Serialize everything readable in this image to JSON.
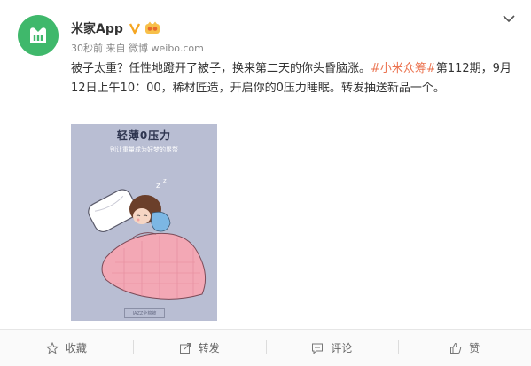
{
  "post": {
    "username": "米家App",
    "time": "30秒前",
    "source_prefix": "来自",
    "source": "微博 weibo.com",
    "text_part1": "被子太重？任性地蹬开了被子，换来第二天的你头昏脑涨。",
    "topic": "#小米众筹#",
    "text_part2": "第112期，9月12日上午10：00，稀材匠造，开启你的0压力睡眠。转发抽送新品一个。"
  },
  "image": {
    "title": "轻薄0压力",
    "subtitle": "别让重量成为好梦的累赘",
    "footer": "JAZZ全棉被"
  },
  "actions": {
    "favorite": "收藏",
    "repost": "转发",
    "comment": "评论",
    "like": "赞"
  },
  "colors": {
    "avatar_bg": "#3fb86b",
    "topic": "#eb7350",
    "verified": "#f5a623",
    "image_bg": "#b9bed3",
    "blanket": "#f3a8b5"
  },
  "icons": {
    "avatar": "mijia-logo-icon",
    "verified": "verified-v-icon",
    "badge": "vip-badge-icon",
    "menu": "chevron-down-icon",
    "favorite": "star-icon",
    "repost": "share-icon",
    "comment": "comment-icon",
    "like": "thumbs-up-icon"
  }
}
